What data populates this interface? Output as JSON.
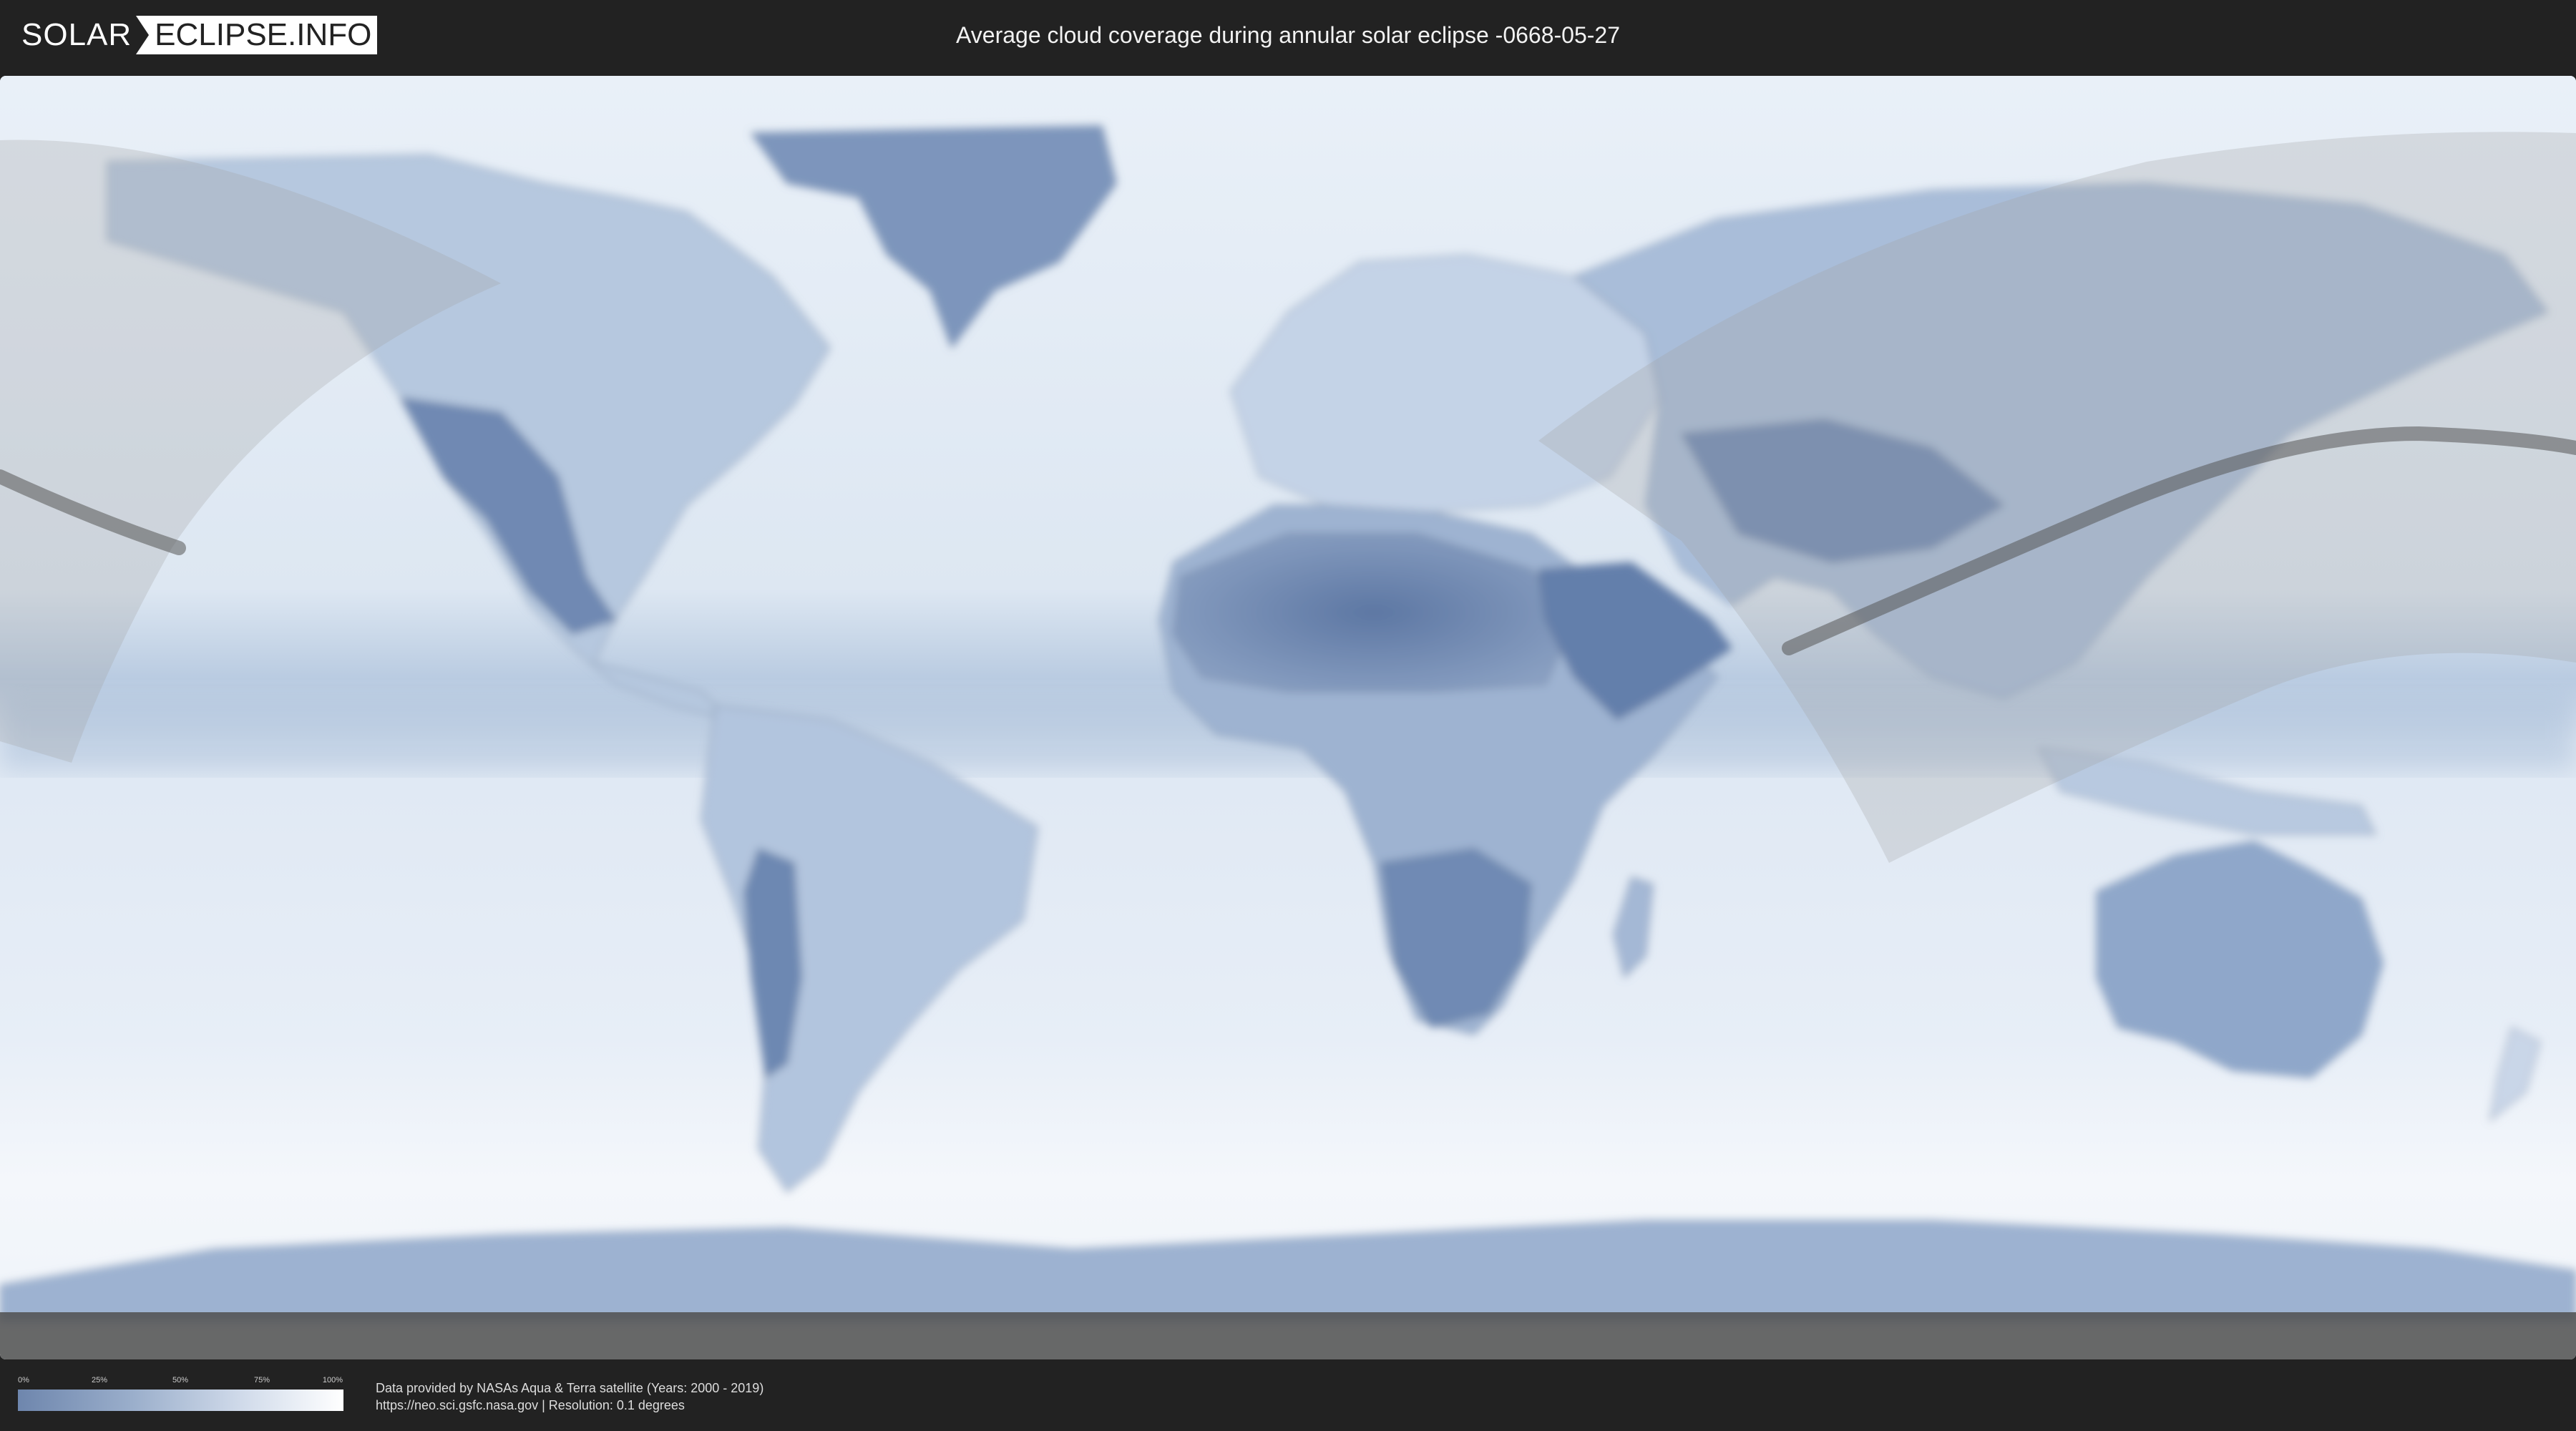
{
  "header": {
    "logo_left": "SOLAR",
    "logo_right": "ECLIPSE.INFO",
    "title": "Average cloud coverage during annular solar eclipse -0668-05-27"
  },
  "legend": {
    "ticks": [
      {
        "label": "0%",
        "value": 0
      },
      {
        "label": "25%",
        "value": 25
      },
      {
        "label": "50%",
        "value": 50
      },
      {
        "label": "75%",
        "value": 75
      },
      {
        "label": "100%",
        "value": 100
      }
    ],
    "color_low": "#6e86ad",
    "color_high": "#ffffff"
  },
  "credits": {
    "line1": "Data provided by NASAs Aqua & Terra satellite (Years: 2000 - 2019)",
    "line2": "https://neo.sci.gsfc.nasa.gov | Resolution: 0.1 degrees"
  },
  "colors": {
    "background": "#222222",
    "ocean_clear": "#eef3f9",
    "land_clear": "#5f7ba6",
    "eclipse_overlay": "#a0a0a0",
    "eclipse_path": "#555555"
  }
}
